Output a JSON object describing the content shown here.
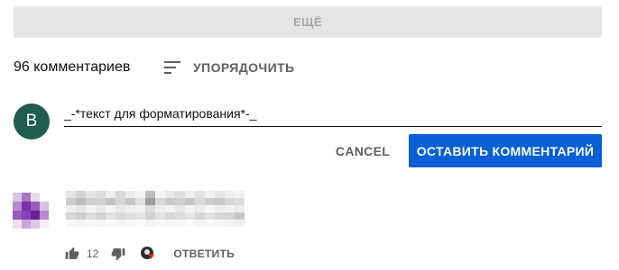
{
  "more_button": {
    "label": "ЕЩЁ"
  },
  "header": {
    "comments_count": "96 комментариев",
    "sort_label": "УПОРЯДОЧИТЬ",
    "sort_icon": "sort-lines-icon"
  },
  "composer": {
    "avatar_letter": "B",
    "avatar_color": "#1f5d4c",
    "input_value": "_-*текст для форматирования*-_",
    "cancel_label": "CANCEL",
    "submit_label": "ОСТАВИТЬ КОММЕНТАРИЙ",
    "submit_color": "#065fd4"
  },
  "comment": {
    "like_count": "12",
    "reply_label": "ОТВЕТИТЬ",
    "like_icon": "thumbs-up-icon",
    "dislike_icon": "thumbs-down-icon",
    "hearted_icon": "creator-heart-icon",
    "heart_color": "#e62117"
  }
}
